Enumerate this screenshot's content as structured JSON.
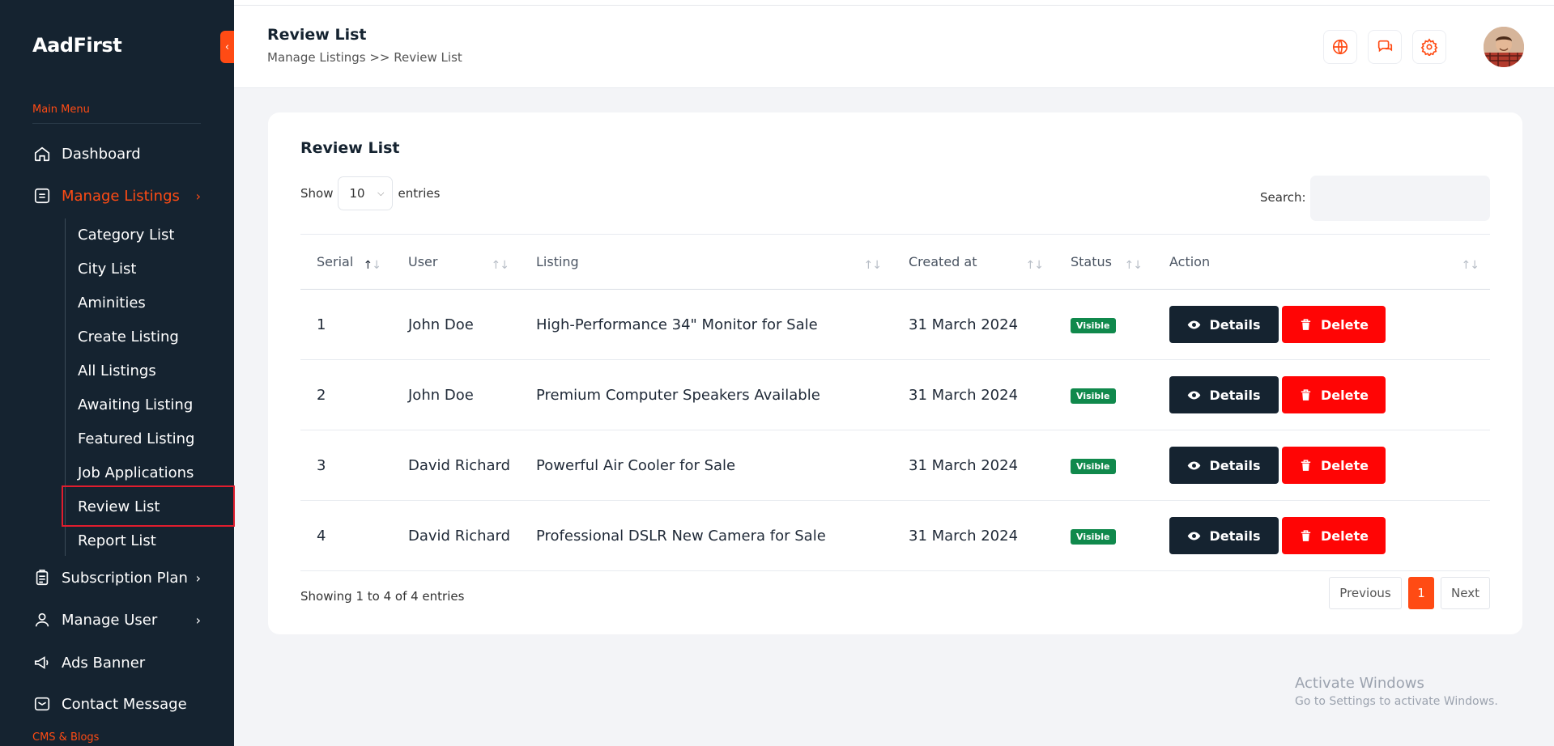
{
  "brand": "AadFirst",
  "colors": {
    "sidebar": "#152330",
    "accent": "#ff4b14",
    "danger": "#ff0505",
    "success": "#10894c"
  },
  "sidebar": {
    "collapse_icon": "chevron-left-icon",
    "section_main": "Main Menu",
    "items": [
      {
        "label": "Dashboard",
        "icon": "home-icon"
      },
      {
        "label": "Manage Listings",
        "icon": "list-icon",
        "chevron": "›"
      },
      {
        "label": "Subscription Plan",
        "icon": "clipboard-icon",
        "chevron": "›"
      },
      {
        "label": "Manage User",
        "icon": "user-icon",
        "chevron": "›"
      },
      {
        "label": "Ads Banner",
        "icon": "megaphone-icon"
      },
      {
        "label": "Contact Message",
        "icon": "mail-icon"
      }
    ],
    "submenu": [
      "Category List",
      "City List",
      "Aminities",
      "Create Listing",
      "All Listings",
      "Awaiting Listing",
      "Featured Listing",
      "Job Applications",
      "Review List",
      "Report List"
    ],
    "section_cms": "CMS & Blogs"
  },
  "header": {
    "title": "Review List",
    "breadcrumb": "Manage Listings >> Review List",
    "icons": [
      "globe-icon",
      "chat-icon",
      "settings-icon"
    ]
  },
  "card": {
    "title": "Review List",
    "show_label": "Show",
    "entries_label": "entries",
    "page_length": "10",
    "search_label": "Search:",
    "search_value": ""
  },
  "table": {
    "columns": [
      "Serial",
      "User",
      "Listing",
      "Created at",
      "Status",
      "Action"
    ],
    "rows": [
      {
        "serial": "1",
        "user": "John Doe",
        "listing": "High-Performance 34\" Monitor for Sale",
        "created": "31 March 2024",
        "status": "Visible"
      },
      {
        "serial": "2",
        "user": "John Doe",
        "listing": "Premium Computer Speakers Available",
        "created": "31 March 2024",
        "status": "Visible"
      },
      {
        "serial": "3",
        "user": "David Richard",
        "listing": "Powerful Air Cooler for Sale",
        "created": "31 March 2024",
        "status": "Visible"
      },
      {
        "serial": "4",
        "user": "David Richard",
        "listing": "Professional DSLR New Camera for Sale",
        "created": "31 March 2024",
        "status": "Visible"
      }
    ],
    "details_label": "Details",
    "delete_label": "Delete"
  },
  "footer": {
    "info": "Showing 1 to 4 of 4 entries",
    "prev": "Previous",
    "current_page": "1",
    "next": "Next"
  },
  "watermark": {
    "line1": "Activate Windows",
    "line2": "Go to Settings to activate Windows."
  }
}
